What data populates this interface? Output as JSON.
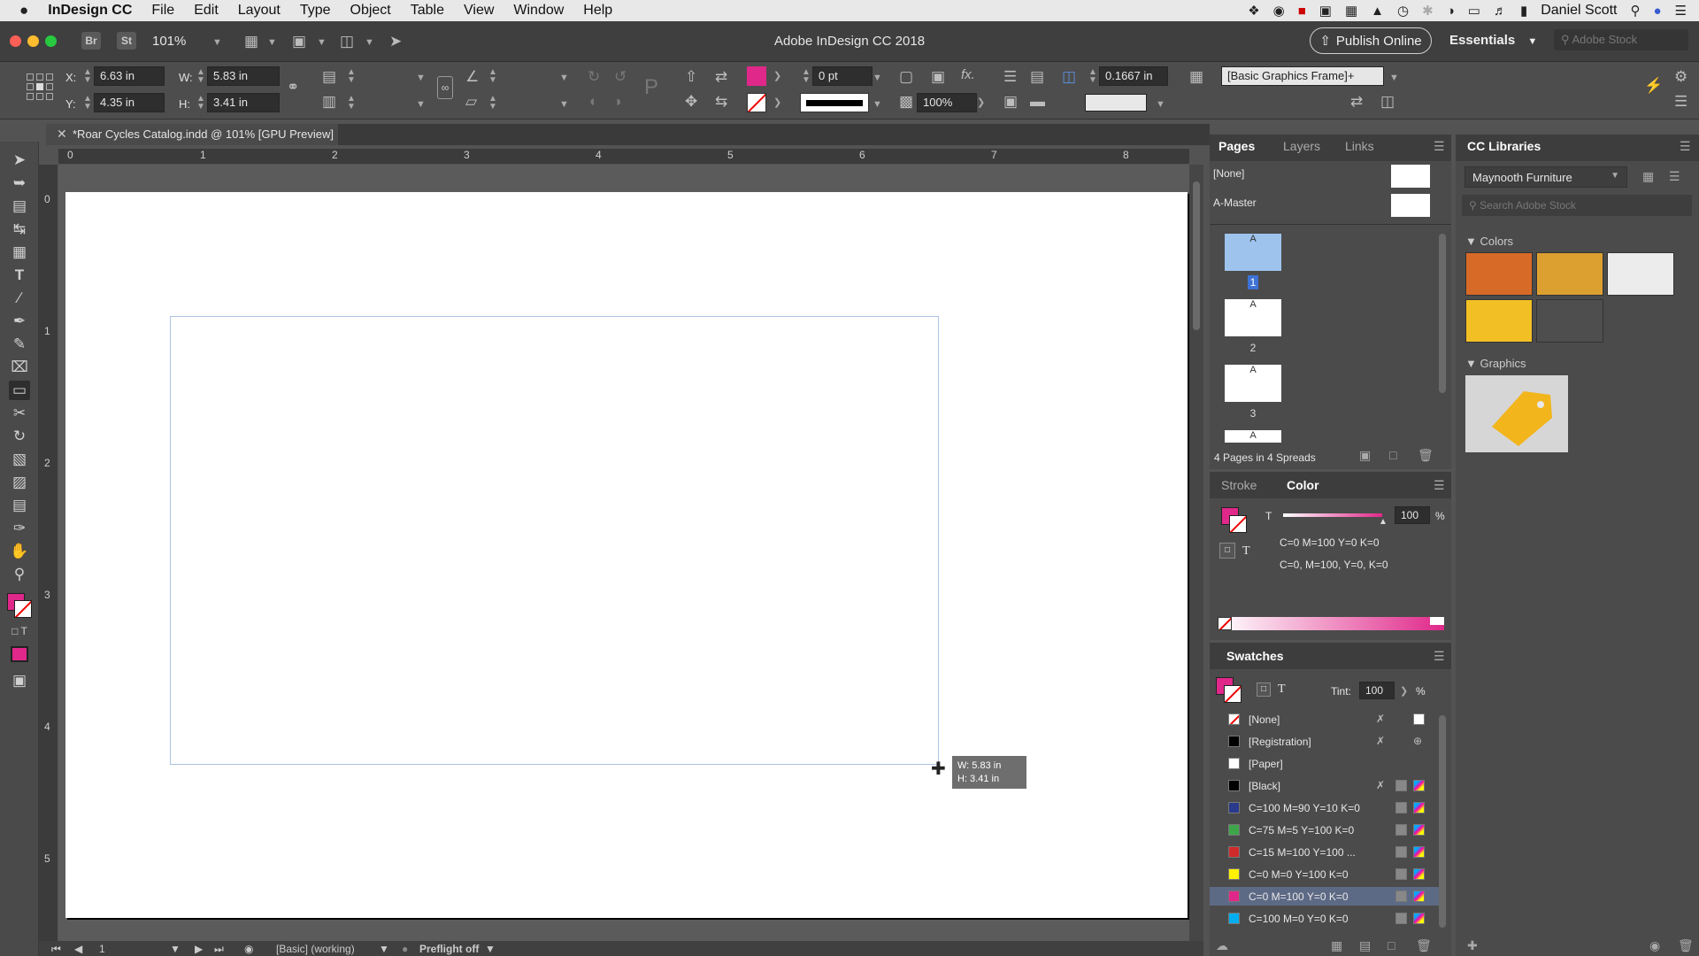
{
  "menubar": {
    "app": "InDesign CC",
    "items": [
      "File",
      "Edit",
      "Layout",
      "Type",
      "Object",
      "Table",
      "View",
      "Window",
      "Help"
    ],
    "user": "Daniel Scott"
  },
  "appbar": {
    "br": "Br",
    "st": "St",
    "zoom": "101%",
    "title": "Adobe InDesign CC 2018",
    "publish": "Publish Online",
    "workspace": "Essentials",
    "stock_placeholder": "Adobe Stock"
  },
  "control": {
    "x_label": "X:",
    "x_value": "6.63 in",
    "y_label": "Y:",
    "y_value": "4.35 in",
    "w_label": "W:",
    "w_value": "5.83 in",
    "h_label": "H:",
    "h_value": "3.41 in",
    "stroke_weight": "0 pt",
    "opacity": "100%",
    "corner": "0.1667 in",
    "style": "[Basic Graphics Frame]+",
    "fill_color": "#e0288a"
  },
  "document": {
    "tab": "*Roar Cycles Catalog.indd @ 101% [GPU Preview]"
  },
  "ruler": {
    "top": [
      "0",
      "1",
      "2",
      "3",
      "4",
      "5",
      "6",
      "7",
      "8"
    ],
    "left": [
      "0",
      "1",
      "2",
      "3",
      "4",
      "5"
    ]
  },
  "tooltip": {
    "w": "W: 5.83 in",
    "h": "H: 3.41 in"
  },
  "statusbar": {
    "page": "1",
    "style": "[Basic] (working)",
    "preflight": "Preflight off"
  },
  "pages_panel": {
    "tabs": [
      "Pages",
      "Layers",
      "Links"
    ],
    "masters": [
      "[None]",
      "A-Master"
    ],
    "pages": [
      {
        "label": "A",
        "num": "1"
      },
      {
        "label": "A",
        "num": "2"
      },
      {
        "label": "A",
        "num": "3"
      },
      {
        "label": "A",
        "num": ""
      }
    ],
    "summary": "4 Pages in 4 Spreads"
  },
  "color_panel": {
    "tabs": [
      "Stroke",
      "Color"
    ],
    "tint": "100",
    "pct": "%",
    "t_label": "T",
    "cmyk_short": "C=0 M=100 Y=0 K=0",
    "cmyk_long": "C=0, M=100, Y=0, K=0"
  },
  "swatches_panel": {
    "title": "Swatches",
    "tint_label": "Tint:",
    "tint": "100",
    "pct": "%",
    "items": [
      {
        "name": "[None]",
        "color": "#ffffff"
      },
      {
        "name": "[Registration]",
        "color": "#000000"
      },
      {
        "name": "[Paper]",
        "color": "#ffffff"
      },
      {
        "name": "[Black]",
        "color": "#000000"
      },
      {
        "name": "C=100 M=90 Y=10 K=0",
        "color": "#2a3a8c"
      },
      {
        "name": "C=75 M=5 Y=100 K=0",
        "color": "#3ea64a"
      },
      {
        "name": "C=15 M=100 Y=100 ...",
        "color": "#d02a2a"
      },
      {
        "name": "C=0 M=0 Y=100 K=0",
        "color": "#fff200"
      },
      {
        "name": "C=0 M=100 Y=0 K=0",
        "color": "#e0288a"
      },
      {
        "name": "C=100 M=0 Y=0 K=0",
        "color": "#00aeef"
      }
    ]
  },
  "cc_libraries": {
    "title": "CC Libraries",
    "library": "Maynooth Furniture",
    "search_placeholder": "Search Adobe Stock",
    "colors_heading": "Colors",
    "colors": [
      "#d86a28",
      "#dca030",
      "#ececec",
      "#f2c024",
      "#4e4e4e"
    ],
    "graphics_heading": "Graphics"
  }
}
